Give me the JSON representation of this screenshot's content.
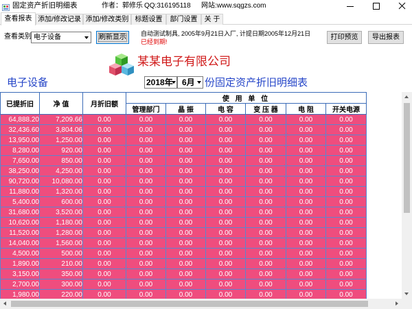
{
  "window": {
    "title": "固定资产折旧明细表",
    "author": "作者：郭修乐",
    "qq": "QQ:316195118",
    "website": "网站:www.sqgzs.com"
  },
  "tabs": [
    {
      "label": "查看报表",
      "active": true
    },
    {
      "label": "添加/修改记录",
      "active": false
    },
    {
      "label": "添加/修改类别",
      "active": false
    },
    {
      "label": "标题设置",
      "active": false
    },
    {
      "label": "部门设置",
      "active": false
    },
    {
      "label": "关 于",
      "active": false
    }
  ],
  "toolbar": {
    "category_label": "查看类别",
    "category_value": "电子设备",
    "refresh_label": "刷新显示",
    "asset_info": "自动测试制具, 2005年9月21日入厂, 计提日期2005年12月21日",
    "status": "已经到期!",
    "print_label": "打印预览",
    "export_label": "导出报表"
  },
  "report": {
    "company": "某某电子有限公司",
    "category": "电子设备",
    "year": "2018年",
    "month": "6月",
    "title_suffix": "份固定资产折旧明细表"
  },
  "table": {
    "headers": {
      "accumulated": "已提折旧",
      "net": "净 值",
      "monthly": "月折旧额",
      "usage_group": "使 用 单 位",
      "units": [
        "管理部门",
        "晶 振",
        "电 容",
        "变 压 器",
        "电 阻",
        "开关电源"
      ]
    },
    "rows": [
      {
        "accumulated": "64,888.20",
        "net": "7,209.66",
        "monthly": "0.00",
        "units": [
          "0.00",
          "0.00",
          "0.00",
          "0.00",
          "0.00",
          "0.00"
        ]
      },
      {
        "accumulated": "32,436.60",
        "net": "3,804.06",
        "monthly": "0.00",
        "units": [
          "0.00",
          "0.00",
          "0.00",
          "0.00",
          "0.00",
          "0.00"
        ]
      },
      {
        "accumulated": "13,950.00",
        "net": "1,250.00",
        "monthly": "0.00",
        "units": [
          "0.00",
          "0.00",
          "0.00",
          "0.00",
          "0.00",
          "0.00"
        ]
      },
      {
        "accumulated": "8,280.00",
        "net": "920.00",
        "monthly": "0.00",
        "units": [
          "0.00",
          "0.00",
          "0.00",
          "0.00",
          "0.00",
          "0.00"
        ]
      },
      {
        "accumulated": "7,650.00",
        "net": "850.00",
        "monthly": "0.00",
        "units": [
          "0.00",
          "0.00",
          "0.00",
          "0.00",
          "0.00",
          "0.00"
        ]
      },
      {
        "accumulated": "38,250.00",
        "net": "4,250.00",
        "monthly": "0.00",
        "units": [
          "0.00",
          "0.00",
          "0.00",
          "0.00",
          "0.00",
          "0.00"
        ]
      },
      {
        "accumulated": "90,720.00",
        "net": "10,080.00",
        "monthly": "0.00",
        "units": [
          "0.00",
          "0.00",
          "0.00",
          "0.00",
          "0.00",
          "0.00"
        ]
      },
      {
        "accumulated": "11,880.00",
        "net": "1,320.00",
        "monthly": "0.00",
        "units": [
          "0.00",
          "0.00",
          "0.00",
          "0.00",
          "0.00",
          "0.00"
        ]
      },
      {
        "accumulated": "5,400.00",
        "net": "600.00",
        "monthly": "0.00",
        "units": [
          "0.00",
          "0.00",
          "0.00",
          "0.00",
          "0.00",
          "0.00"
        ]
      },
      {
        "accumulated": "31,680.00",
        "net": "3,520.00",
        "monthly": "0.00",
        "units": [
          "0.00",
          "0.00",
          "0.00",
          "0.00",
          "0.00",
          "0.00"
        ]
      },
      {
        "accumulated": "10,620.00",
        "net": "1,180.00",
        "monthly": "0.00",
        "units": [
          "0.00",
          "0.00",
          "0.00",
          "0.00",
          "0.00",
          "0.00"
        ]
      },
      {
        "accumulated": "11,520.00",
        "net": "1,280.00",
        "monthly": "0.00",
        "units": [
          "0.00",
          "0.00",
          "0.00",
          "0.00",
          "0.00",
          "0.00"
        ]
      },
      {
        "accumulated": "14,040.00",
        "net": "1,560.00",
        "monthly": "0.00",
        "units": [
          "0.00",
          "0.00",
          "0.00",
          "0.00",
          "0.00",
          "0.00"
        ]
      },
      {
        "accumulated": "4,500.00",
        "net": "500.00",
        "monthly": "0.00",
        "units": [
          "0.00",
          "0.00",
          "0.00",
          "0.00",
          "0.00",
          "0.00"
        ]
      },
      {
        "accumulated": "1,890.00",
        "net": "210.00",
        "monthly": "0.00",
        "units": [
          "0.00",
          "0.00",
          "0.00",
          "0.00",
          "0.00",
          "0.00"
        ]
      },
      {
        "accumulated": "3,150.00",
        "net": "350.00",
        "monthly": "0.00",
        "units": [
          "0.00",
          "0.00",
          "0.00",
          "0.00",
          "0.00",
          "0.00"
        ]
      },
      {
        "accumulated": "2,700.00",
        "net": "300.00",
        "monthly": "0.00",
        "units": [
          "0.00",
          "0.00",
          "0.00",
          "0.00",
          "0.00",
          "0.00"
        ]
      },
      {
        "accumulated": "1,980.00",
        "net": "220.00",
        "monthly": "0.00",
        "units": [
          "0.00",
          "0.00",
          "0.00",
          "0.00",
          "0.00",
          "0.00"
        ]
      }
    ]
  },
  "icons": {
    "app": "app-icon",
    "logo": "cubes-logo-icon",
    "minimize": "minimize-icon",
    "maximize": "maximize-icon",
    "close": "close-icon",
    "dropdown": "chevron-down-icon"
  },
  "colors": {
    "cell_background": "#ef4d7e",
    "cell_text": "#ffffff",
    "grid_line": "#5a86d0",
    "header_line": "#3b6cb8",
    "title_blue": "#2545c8",
    "company_red": "#d01818",
    "status_red": "#e00000"
  }
}
